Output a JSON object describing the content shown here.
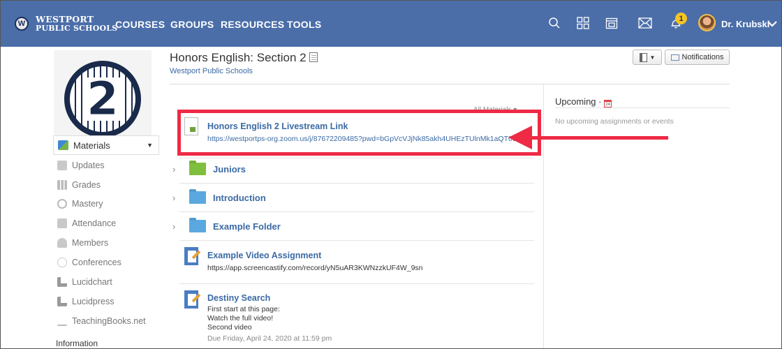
{
  "header": {
    "logo_line1": "WESTPORT",
    "logo_line2": "PUBLIC SCHOOLS",
    "logo_seal": "W",
    "nav": [
      "COURSES",
      "GROUPS",
      "RESOURCES",
      "TOOLS"
    ],
    "notification_count": "1",
    "user_name": "Dr. Krubski",
    "brand_color": "#4b6ea9"
  },
  "sidebar": {
    "profile_number": "2",
    "materials_label": "Materials",
    "items": [
      "Updates",
      "Grades",
      "Mastery",
      "Attendance",
      "Members",
      "Conferences",
      "Lucidchart",
      "Lucidpress",
      "TeachingBooks.net"
    ],
    "info_label": "Information"
  },
  "course": {
    "title": "Honors English: Section 2",
    "school": "Westport Public Schools",
    "notifications_label": "Notifications",
    "all_materials_label": "All Materials ▾"
  },
  "materials": {
    "livestream": {
      "title": "Honors English 2 Livestream Link",
      "url": "https://westportps-org.zoom.us/j/87672209485?pwd=bGpVcVJjNk85akh4UHEzTUlnMk1aQT09"
    },
    "folders": [
      {
        "name": "Juniors",
        "color": "#7fbf3e"
      },
      {
        "name": "Introduction",
        "color": "#5aa8df"
      },
      {
        "name": "Example Folder",
        "color": "#5aa8df"
      }
    ],
    "video_assignment": {
      "title": "Example Video Assignment",
      "url": "https://app.screencastify.com/record/yN5uAR3KWNzzkUF4W_9sn"
    },
    "destiny": {
      "title": "Destiny Search",
      "lines": [
        "First start at this page:",
        "Watch the full video!",
        "Second video"
      ],
      "due": "Due Friday, April 24, 2020 at 11:59 pm"
    }
  },
  "upcoming": {
    "title": "Upcoming ·",
    "calendar_day": "24",
    "empty": "No upcoming assignments or events"
  },
  "annotation_color": "#ee2a45"
}
